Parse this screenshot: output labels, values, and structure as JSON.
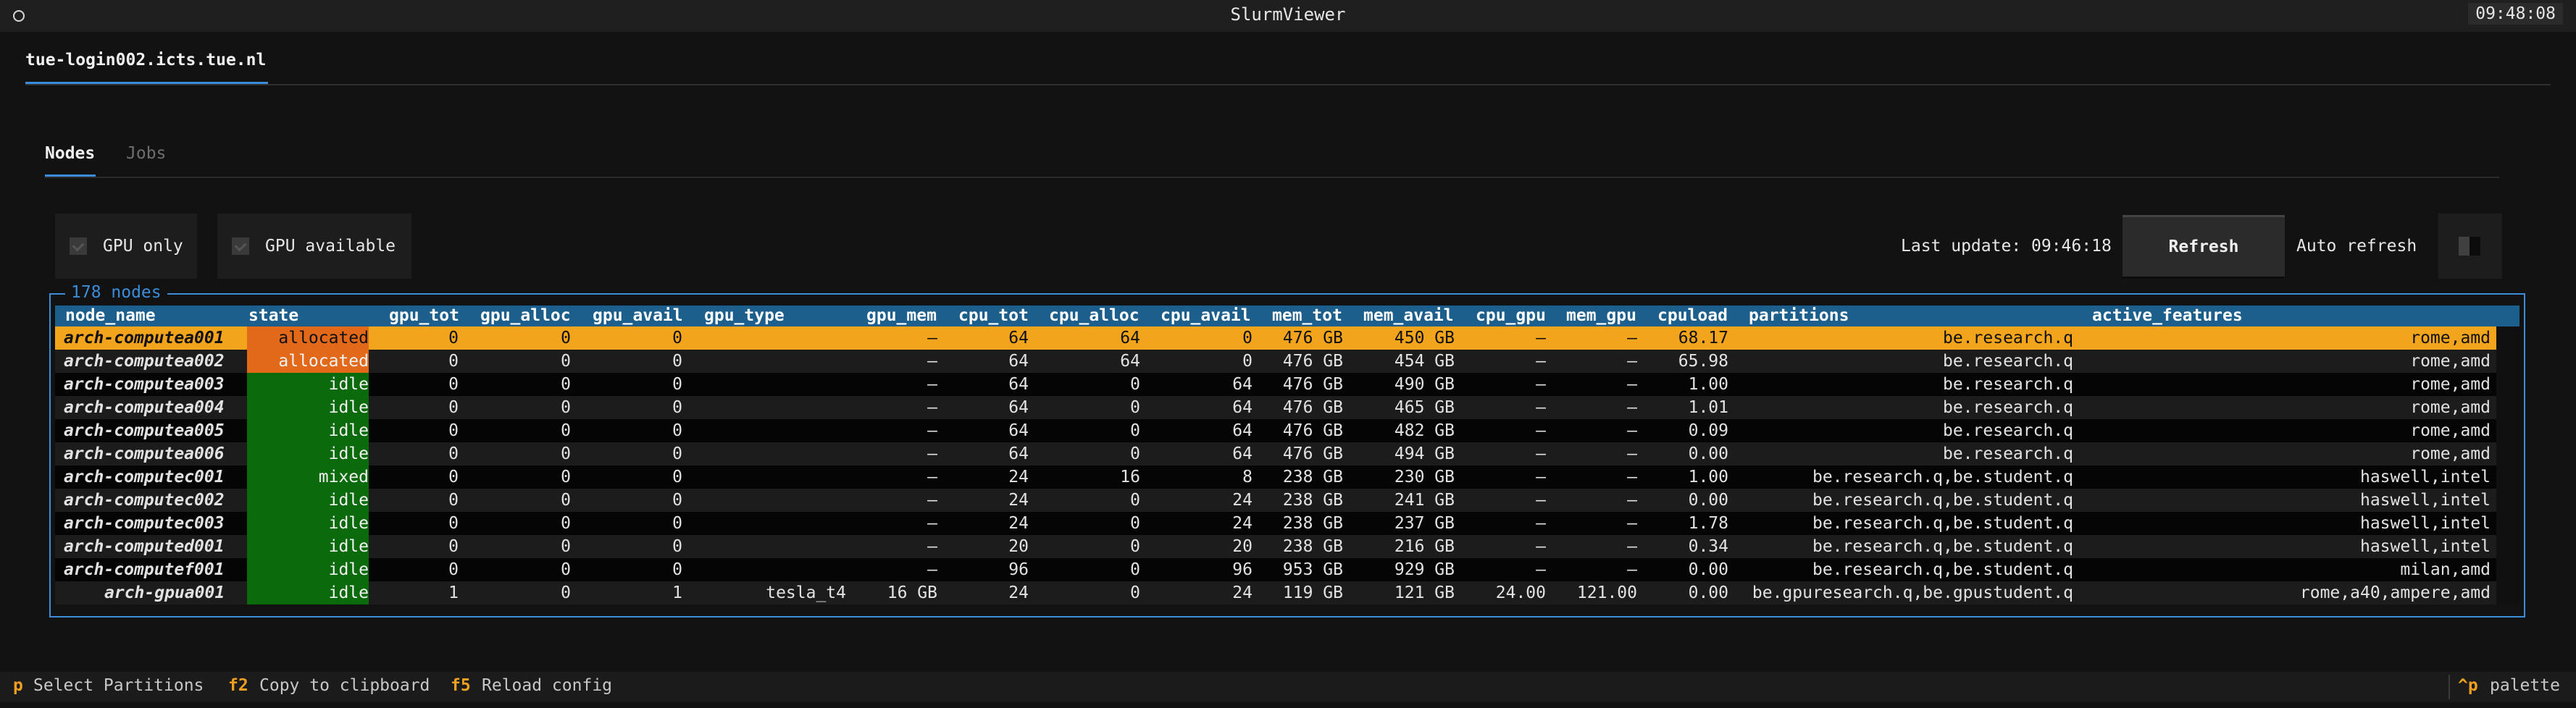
{
  "app": {
    "title": "SlurmViewer",
    "clock": "09:48:08"
  },
  "host_tab": "tue-login002.icts.tue.nl",
  "tabs": [
    {
      "label": "Nodes"
    },
    {
      "label": "Jobs"
    }
  ],
  "toolbar": {
    "gpu_only_label": "GPU only",
    "gpu_available_label": "GPU available",
    "last_update": "Last update: 09:46:18",
    "refresh_label": "Refresh",
    "auto_refresh_label": "Auto refresh",
    "auto_refresh_on": false,
    "gpu_only_checked": false,
    "gpu_available_checked": false
  },
  "table": {
    "legend": "178 nodes",
    "columns": [
      "node_name",
      "state",
      "gpu_tot",
      "gpu_alloc",
      "gpu_avail",
      "gpu_type",
      "gpu_mem",
      "cpu_tot",
      "cpu_alloc",
      "cpu_avail",
      "mem_tot",
      "mem_avail",
      "cpu_gpu",
      "mem_gpu",
      "cpuload",
      "partitions",
      "active_features"
    ],
    "rows": [
      [
        "arch-computea001",
        "allocated",
        "0",
        "0",
        "0",
        "",
        "–",
        "64",
        "64",
        "0",
        "476 GB",
        "450 GB",
        "–",
        "–",
        "68.17",
        "be.research.q",
        "rome,amd"
      ],
      [
        "arch-computea002",
        "allocated",
        "0",
        "0",
        "0",
        "",
        "–",
        "64",
        "64",
        "0",
        "476 GB",
        "454 GB",
        "–",
        "–",
        "65.98",
        "be.research.q",
        "rome,amd"
      ],
      [
        "arch-computea003",
        "idle",
        "0",
        "0",
        "0",
        "",
        "–",
        "64",
        "0",
        "64",
        "476 GB",
        "490 GB",
        "–",
        "–",
        "1.00",
        "be.research.q",
        "rome,amd"
      ],
      [
        "arch-computea004",
        "idle",
        "0",
        "0",
        "0",
        "",
        "–",
        "64",
        "0",
        "64",
        "476 GB",
        "465 GB",
        "–",
        "–",
        "1.01",
        "be.research.q",
        "rome,amd"
      ],
      [
        "arch-computea005",
        "idle",
        "0",
        "0",
        "0",
        "",
        "–",
        "64",
        "0",
        "64",
        "476 GB",
        "482 GB",
        "–",
        "–",
        "0.09",
        "be.research.q",
        "rome,amd"
      ],
      [
        "arch-computea006",
        "idle",
        "0",
        "0",
        "0",
        "",
        "–",
        "64",
        "0",
        "64",
        "476 GB",
        "494 GB",
        "–",
        "–",
        "0.00",
        "be.research.q",
        "rome,amd"
      ],
      [
        "arch-computec001",
        "mixed",
        "0",
        "0",
        "0",
        "",
        "–",
        "24",
        "16",
        "8",
        "238 GB",
        "230 GB",
        "–",
        "–",
        "1.00",
        "be.research.q,be.student.q",
        "haswell,intel"
      ],
      [
        "arch-computec002",
        "idle",
        "0",
        "0",
        "0",
        "",
        "–",
        "24",
        "0",
        "24",
        "238 GB",
        "241 GB",
        "–",
        "–",
        "0.00",
        "be.research.q,be.student.q",
        "haswell,intel"
      ],
      [
        "arch-computec003",
        "idle",
        "0",
        "0",
        "0",
        "",
        "–",
        "24",
        "0",
        "24",
        "238 GB",
        "237 GB",
        "–",
        "–",
        "1.78",
        "be.research.q,be.student.q",
        "haswell,intel"
      ],
      [
        "arch-computed001",
        "idle",
        "0",
        "0",
        "0",
        "",
        "–",
        "20",
        "0",
        "20",
        "238 GB",
        "216 GB",
        "–",
        "–",
        "0.34",
        "be.research.q,be.student.q",
        "haswell,intel"
      ],
      [
        "arch-computef001",
        "idle",
        "0",
        "0",
        "0",
        "",
        "–",
        "96",
        "0",
        "96",
        "953 GB",
        "929 GB",
        "–",
        "–",
        "0.00",
        "be.research.q,be.student.q",
        "milan,amd"
      ],
      [
        "arch-gpua001",
        "idle",
        "1",
        "0",
        "1",
        "tesla_t4",
        "16 GB",
        "24",
        "0",
        "24",
        "119 GB",
        "121 GB",
        "24.00",
        "121.00",
        "0.00",
        "be.gpuresearch.q,be.gpustudent.q",
        "rome,a40,ampere,amd"
      ]
    ],
    "selected_row": 0
  },
  "footer": {
    "bindings": [
      {
        "key": "p",
        "label": "Select Partitions"
      },
      {
        "key": "f2",
        "label": "Copy to clipboard"
      },
      {
        "key": "f5",
        "label": "Reload config"
      }
    ],
    "palette_key": "^p",
    "palette_label": "palette"
  },
  "colors": {
    "accent": "#3b8dd9",
    "header_bg": "#1d5f8c",
    "selected_row": "#f2a51c",
    "allocated": "#e2691a",
    "idle": "#0b6a0b",
    "key": "#f0a020"
  }
}
